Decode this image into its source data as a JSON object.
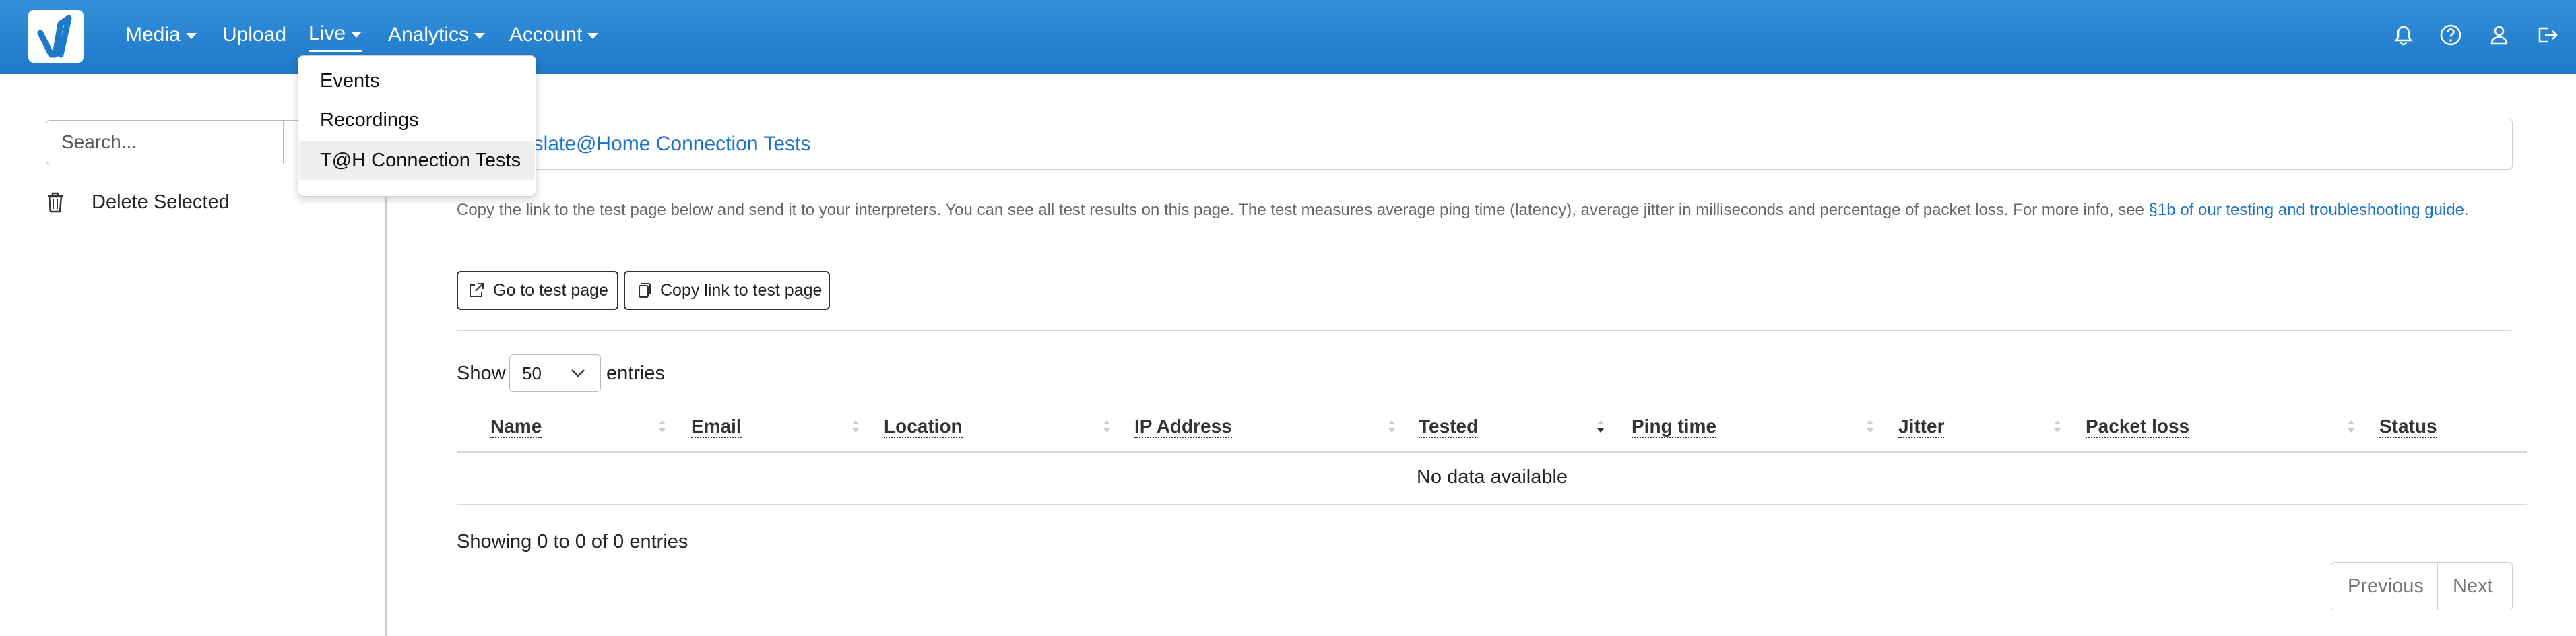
{
  "nav": {
    "items": [
      "Media",
      "Upload",
      "Live",
      "Analytics",
      "Account"
    ],
    "active": "Live",
    "icons": [
      "bell-icon",
      "help-icon",
      "user-icon",
      "logout-icon"
    ]
  },
  "dropdown": {
    "items": [
      "Events",
      "Recordings",
      "T@H Connection Tests"
    ],
    "active": "T@H Connection Tests"
  },
  "sidebar": {
    "search_placeholder": "Search...",
    "delete_label": "Delete Selected"
  },
  "main": {
    "title": "Translate@Home Connection Tests",
    "description": "Copy the link to the test page below and send it to your interpreters. You can see all test results on this page. The test measures average ping time (latency), average jitter in milliseconds and percentage of packet loss. For more info, see ",
    "description_link": "§1b of our testing and troubleshooting guide",
    "description_end": ".",
    "buttons": {
      "go_test": "Go to test page",
      "copy_link": "Copy link to test page"
    },
    "show_label": "Show",
    "entries_value": "50",
    "entries_label": "entries",
    "table": {
      "columns": [
        "Name",
        "Email",
        "Location",
        "IP Address",
        "Tested",
        "Ping time",
        "Jitter",
        "Packet loss",
        "Status"
      ],
      "sorted_column": "Tested",
      "sort_direction": "desc",
      "empty_message": "No data available"
    },
    "info": "Showing 0 to 0 of 0 entries",
    "pagination": {
      "previous": "Previous",
      "next": "Next"
    }
  },
  "colors": {
    "navbar": "#1e79c9",
    "link": "#1a73c8"
  }
}
